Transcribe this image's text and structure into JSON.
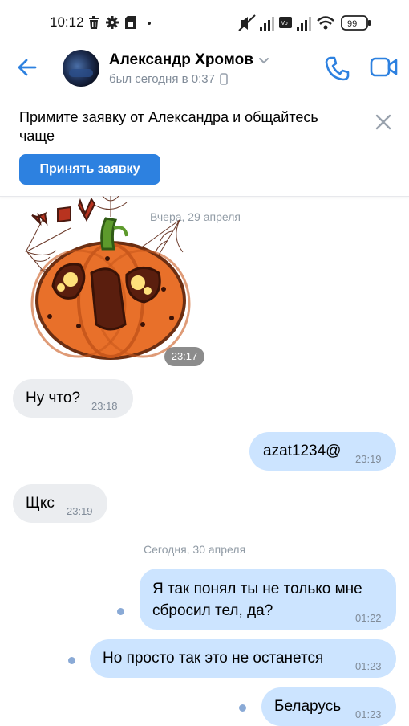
{
  "status": {
    "time": "10:12",
    "battery": "99"
  },
  "header": {
    "name": "Александр Хромов",
    "last_seen": "был сегодня в 0:37"
  },
  "banner": {
    "text": "Примите заявку от Александра и общайтесь чаще",
    "accept_label": "Принять заявку"
  },
  "chat": {
    "date_yesterday": "Вчера, 29 апреля",
    "sticker_time": "23:17",
    "date_today": "Сегодня, 30 апреля",
    "messages": [
      {
        "text": "Ну что?",
        "time": "23:18",
        "dir": "in"
      },
      {
        "text": "azat1234@",
        "time": "23:19",
        "dir": "out"
      },
      {
        "text": "Щкс",
        "time": "23:19",
        "dir": "in"
      },
      {
        "text": "Я так понял ты не только мне сбросил тел, да?",
        "time": "01:22",
        "dir": "out"
      },
      {
        "text": "Но просто так это не останется",
        "time": "01:23",
        "dir": "out"
      },
      {
        "text": "Беларусь",
        "time": "01:23",
        "dir": "out"
      }
    ]
  },
  "icons": {
    "back": "arrow-left-icon",
    "call": "phone-icon",
    "video": "video-camera-icon",
    "close": "close-icon"
  },
  "colors": {
    "accent": "#2d81e0",
    "outgoing_bubble": "#cce4ff",
    "incoming_bubble": "#ebedf0",
    "secondary_text": "#818c99"
  }
}
